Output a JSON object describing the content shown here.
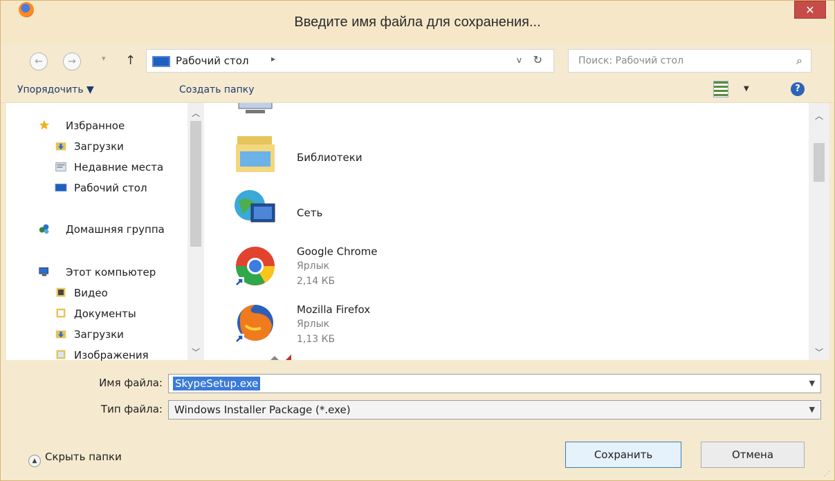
{
  "window": {
    "title": "Введите имя файла для сохранения...",
    "close_label": "✕"
  },
  "nav": {
    "back_glyph": "←",
    "forward_glyph": "→",
    "recent_glyph": "▾",
    "up_glyph": "↑"
  },
  "address": {
    "path": "Рабочий стол",
    "separator": "▸",
    "dropdown": "v",
    "refresh": "↻"
  },
  "search": {
    "placeholder": "Поиск: Рабочий стол",
    "icon": "⌕"
  },
  "toolbar": {
    "organize": "Упорядочить ▼",
    "new_folder": "Создать папку",
    "view_drop": "▼",
    "help": "?"
  },
  "sidebar": {
    "items": [
      {
        "label": "Избранное",
        "icon": "star-icon"
      },
      {
        "label": "Загрузки",
        "icon": "downloads-icon"
      },
      {
        "label": "Недавние места",
        "icon": "recent-places-icon"
      },
      {
        "label": "Рабочий стол",
        "icon": "desktop-icon"
      },
      {
        "label": "Домашняя группа",
        "icon": "homegroup-icon"
      },
      {
        "label": "Этот компьютер",
        "icon": "computer-icon"
      },
      {
        "label": "Видео",
        "icon": "video-icon"
      },
      {
        "label": "Документы",
        "icon": "documents-icon"
      },
      {
        "label": "Загрузки",
        "icon": "downloads-icon"
      },
      {
        "label": "Изображения",
        "icon": "images-icon"
      }
    ]
  },
  "files": {
    "items": [
      {
        "name": "Библиотеки",
        "icon": "libraries-icon"
      },
      {
        "name": "Сеть",
        "icon": "network-icon"
      },
      {
        "name": "Google Chrome",
        "type": "Ярлык",
        "size": "2,14 КБ",
        "icon": "chrome-icon"
      },
      {
        "name": "Mozilla Firefox",
        "type": "Ярлык",
        "size": "1,13 КБ",
        "icon": "firefox-icon"
      }
    ]
  },
  "form": {
    "filename_label": "Имя файла:",
    "filename_value": "SkypeSetup.exe",
    "filetype_label": "Тип файла:",
    "filetype_value": "Windows Installer Package (*.exe)"
  },
  "footer": {
    "hide_folders": "Скрыть папки",
    "save": "Сохранить",
    "cancel": "Отмена"
  },
  "colors": {
    "accent": "#3a7ad8",
    "close": "#c74b48",
    "frame": "#f5e9cf"
  }
}
